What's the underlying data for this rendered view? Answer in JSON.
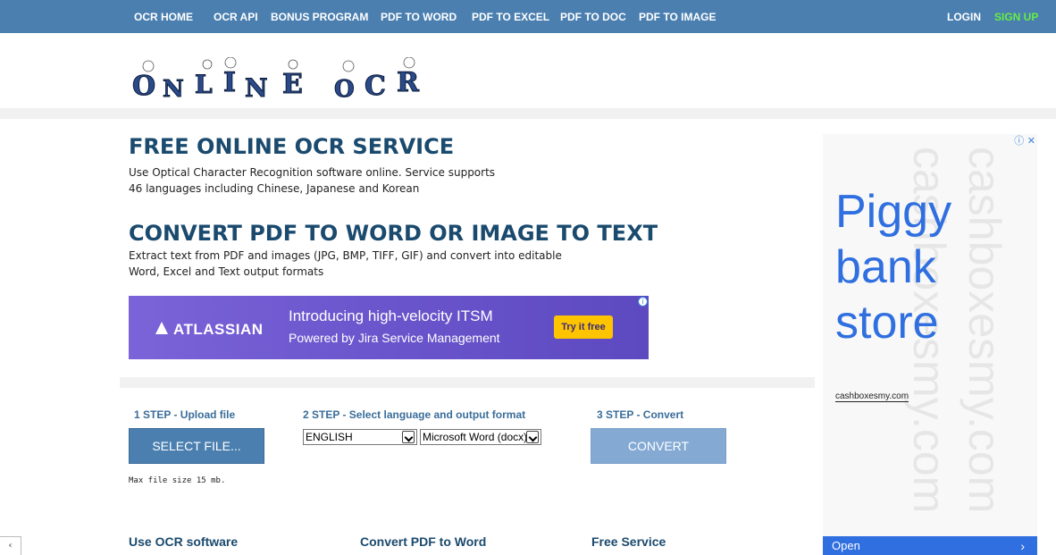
{
  "nav": {
    "items": [
      "OCR HOME",
      "OCR API",
      "BONUS PROGRAM",
      "PDF TO WORD",
      "PDF TO EXCEL",
      "PDF TO DOC",
      "PDF TO IMAGE"
    ],
    "login": "LOGIN",
    "signup": "SIGN UP"
  },
  "logo": {
    "text": "ONLINE OCR"
  },
  "intro": {
    "title1": "FREE ONLINE OCR SERVICE",
    "desc1a": "Use Optical Character Recognition software online. Service supports",
    "desc1b": "46 languages including Chinese, Japanese and Korean",
    "title2": "CONVERT PDF TO WORD OR IMAGE TO TEXT",
    "desc2a": "Extract text from PDF and images (JPG, BMP, TIFF, GIF) and convert into editable",
    "desc2b": "Word, Excel and Text output formats"
  },
  "banner_ad": {
    "brand": "ATLASSIAN",
    "headline": "Introducing high-velocity ITSM",
    "subline": "Powered by Jira Service Management",
    "cta": "Try it free"
  },
  "steps": {
    "step1_label": "1 STEP - Upload file",
    "step2_label": "2 STEP - Select language and output format",
    "step3_label": "3 STEP - Convert",
    "select_file": "SELECT FILE...",
    "language_value": "ENGLISH",
    "format_value": "Microsoft Word (docx)",
    "convert": "CONVERT",
    "max_size": "Max file size 15 mb."
  },
  "footer": {
    "col1": "Use OCR software",
    "col2": "Convert PDF to Word",
    "col3": "Free Service"
  },
  "side_ad": {
    "line1": "Piggy",
    "line2": "bank",
    "line3": "store",
    "domain": "cashboxesmy.com",
    "open": "Open"
  },
  "colors": {
    "nav_bg": "#4a7fb0",
    "signup": "#66ee44",
    "heading": "#1a4a6e",
    "step_label": "#3a6d9a",
    "ad_blue": "#2f6fe0"
  }
}
